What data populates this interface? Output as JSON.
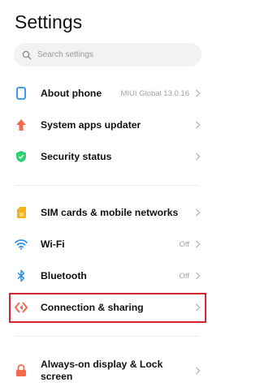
{
  "header": {
    "title": "Settings"
  },
  "search": {
    "placeholder": "Search settings"
  },
  "items": [
    {
      "label": "About phone",
      "value": "MIUI Global 13.0.16",
      "icon": "phone-icon",
      "color": "#2f8fe8"
    },
    {
      "label": "System apps updater",
      "value": "",
      "icon": "arrow-up-icon",
      "color": "#f26a4b"
    },
    {
      "label": "Security status",
      "value": "",
      "icon": "shield-check-icon",
      "color": "#2fcf74"
    },
    {
      "label": "SIM cards & mobile networks",
      "value": "",
      "icon": "sim-card-icon",
      "color": "#f5b21b"
    },
    {
      "label": "Wi-Fi",
      "value": "Off",
      "icon": "wifi-icon",
      "color": "#2f8fe8"
    },
    {
      "label": "Bluetooth",
      "value": "Off",
      "icon": "bluetooth-icon",
      "color": "#2f8fe8"
    },
    {
      "label": "Connection & sharing",
      "value": "",
      "icon": "connection-sharing-icon",
      "color": "#f26a4b"
    },
    {
      "label": "Always-on display & Lock screen",
      "value": "",
      "icon": "lock-icon",
      "color": "#f26a4b"
    }
  ],
  "highlight_color": "#d9232e"
}
